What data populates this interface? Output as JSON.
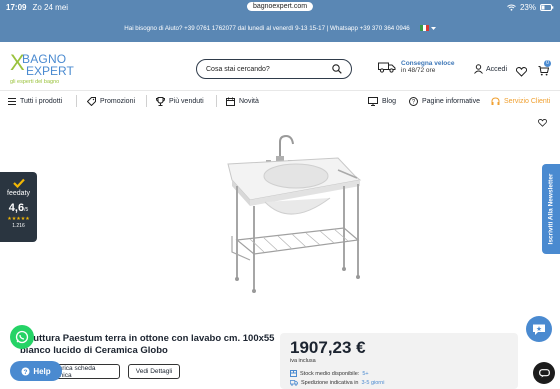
{
  "status_bar": {
    "time": "17:09",
    "date": "Zo 24 mei",
    "url": "bagnoexpert.com",
    "battery": "23%"
  },
  "topbar": {
    "text": "Hai bisogno di Aiuto? +39 0761 1762077 dal lunedì al venerdì 9-13 15-17 | Whatsapp +39 370 364 0946"
  },
  "logo": {
    "line1": "BAGNO",
    "line2": "EXPERT",
    "tagline": "gli esperti del bagno"
  },
  "search": {
    "placeholder": "Cosa stai cercando?"
  },
  "shipping": {
    "title": "Consegna veloce",
    "subtitle": "in 48/72 ore"
  },
  "account": {
    "label": "Accedi"
  },
  "cart": {
    "count": "0"
  },
  "nav": {
    "all_products": "Tutti i prodotti",
    "promotions": "Promozioni",
    "best_sellers": "Più venduti",
    "news": "Novità",
    "blog": "Blog",
    "info_pages": "Pagine informative",
    "customer_service": "Servizio Clienti"
  },
  "feedaty": {
    "brand": "feedaty",
    "score": "4,6",
    "scale": "/5",
    "reviews": "1.216"
  },
  "newsletter": {
    "label": "Iscriviti Alla Newsletter"
  },
  "product": {
    "title": "Struttura Paestum terra in ottone con lavabo cm. 100x55 bianco lucido di Ceramica Globo",
    "sheet_button": "Scarica scheda tecnica",
    "details_button": "Vedi Dettagli",
    "price": "1907,23 €",
    "vat": "iva inclusa",
    "stock_label": "Stock medio disponibile:",
    "stock_value": "5+",
    "shipping_label": "Spedizione indicativa in",
    "shipping_value": "3-5 giorni"
  },
  "help_button": {
    "label": "Help"
  },
  "colors": {
    "brand_blue": "#5a87b4",
    "accent_blue": "#4a8ad0",
    "green": "#9ac23c",
    "orange": "#f0a030"
  }
}
